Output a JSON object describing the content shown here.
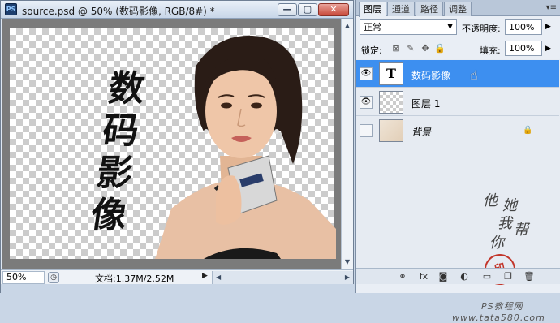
{
  "document": {
    "title": "source.psd @ 50% (数码影像, RGB/8#) *",
    "app_icon": "PS",
    "canvas_text": "数码影像",
    "zoom": "50%",
    "doc_info": "文档:1.37M/2.52M"
  },
  "window_controls": {
    "minimize": "—",
    "maximize": "▢",
    "close": "✕"
  },
  "panel": {
    "tabs": [
      {
        "label": "图层",
        "active": true
      },
      {
        "label": "通道",
        "active": false
      },
      {
        "label": "路径",
        "active": false
      },
      {
        "label": "调整",
        "active": false
      }
    ],
    "menu_icon": "▾≡",
    "blend_mode": "正常",
    "opacity_label": "不透明度:",
    "opacity": "100%",
    "lock_label": "锁定:",
    "fill_label": "填充:",
    "fill": "100%",
    "layers": [
      {
        "name": "数码影像",
        "type": "text",
        "thumb": "T",
        "visible": true,
        "selected": true,
        "locked": false
      },
      {
        "name": "图层 1",
        "type": "pixel",
        "thumb": "",
        "visible": true,
        "selected": false,
        "locked": false
      },
      {
        "name": "背景",
        "type": "background",
        "thumb": "",
        "visible": false,
        "selected": false,
        "locked": true
      }
    ],
    "watermark": {
      "chars": [
        "他",
        "她",
        "我",
        "帮",
        "你"
      ],
      "seal": "印",
      "brand": "PS教程网",
      "url": "www.tata580.com"
    },
    "bottom_icons": [
      "link-icon",
      "fx-icon",
      "mask-icon",
      "adjustment-icon",
      "group-icon",
      "new-layer-icon",
      "trash-icon"
    ],
    "bottom_glyphs": [
      "⚭",
      "fx",
      "◙",
      "◐",
      "▭",
      "❐",
      "🗑"
    ]
  },
  "colors": {
    "selection": "#3d8ff0",
    "chrome": "#c9d6e6"
  }
}
